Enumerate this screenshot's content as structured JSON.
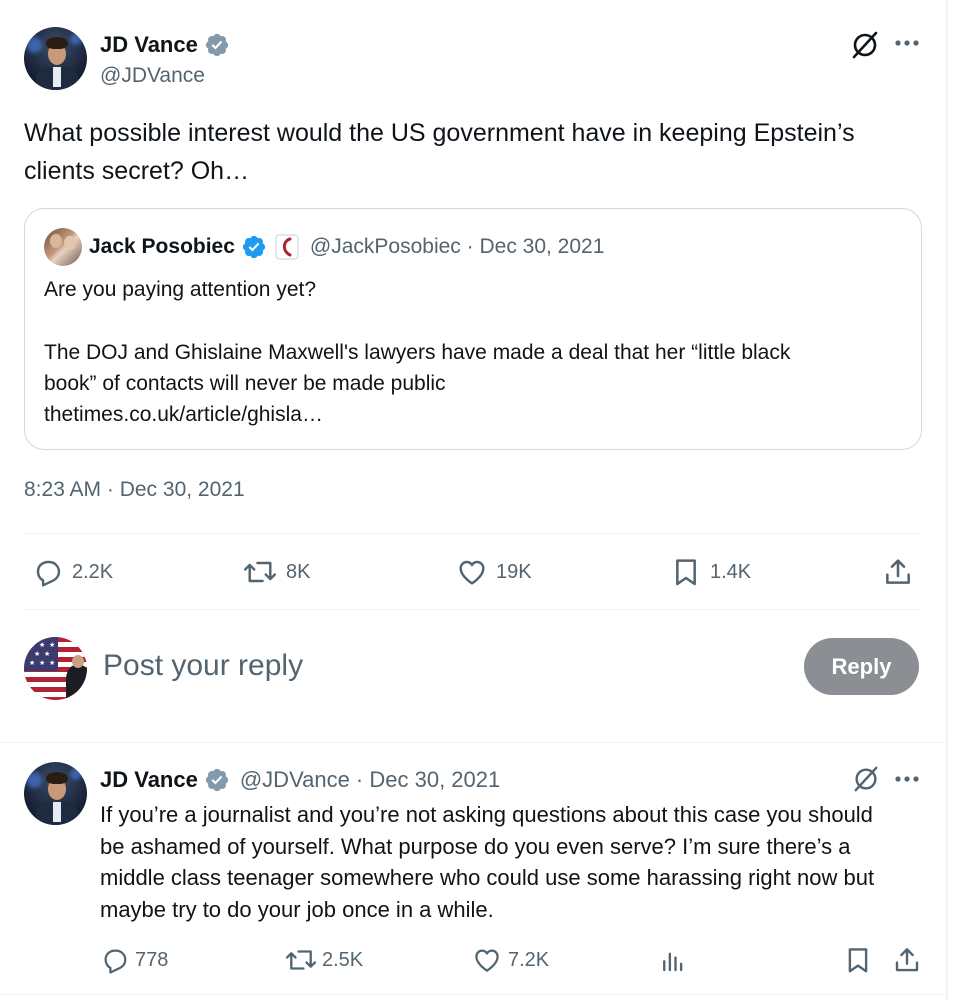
{
  "main_tweet": {
    "author_name": "JD Vance",
    "author_handle": "@JDVance",
    "text": "What possible interest would the US government have in keeping Epstein’s clients secret? Oh…",
    "timestamp": "8:23 AM · Dec 30, 2021",
    "metrics": {
      "replies": "2.2K",
      "retweets": "8K",
      "likes": "19K",
      "bookmarks": "1.4K"
    }
  },
  "quoted_tweet": {
    "author_name": "Jack Posobiec",
    "author_handle_date": "@JackPosobiec · Dec 30, 2021",
    "line1": "Are you paying attention yet?",
    "line2": "The DOJ and Ghislaine Maxwell's lawyers have made a deal that her “little black",
    "line3": "book” of contacts will never be made public",
    "link": "thetimes.co.uk/article/ghisla…"
  },
  "reply_composer": {
    "placeholder": "Post your reply",
    "button_label": "Reply"
  },
  "reply_tweet": {
    "author_name": "JD Vance",
    "author_handle_date": "@JDVance · Dec 30, 2021",
    "text": "If you’re a journalist and you’re not asking questions about this case you should be ashamed of yourself. What purpose do you even serve? I’m sure there’s a middle class teenager somewhere who could use some harassing right now but maybe try to do your job once in a while.",
    "metrics": {
      "replies": "778",
      "retweets": "2.5K",
      "likes": "7.2K"
    }
  },
  "colors": {
    "verified_gray": "#829aab",
    "verified_blue": "#1d9bf0",
    "secondary_text": "#536471",
    "reply_button_bg": "#8b8f93"
  }
}
